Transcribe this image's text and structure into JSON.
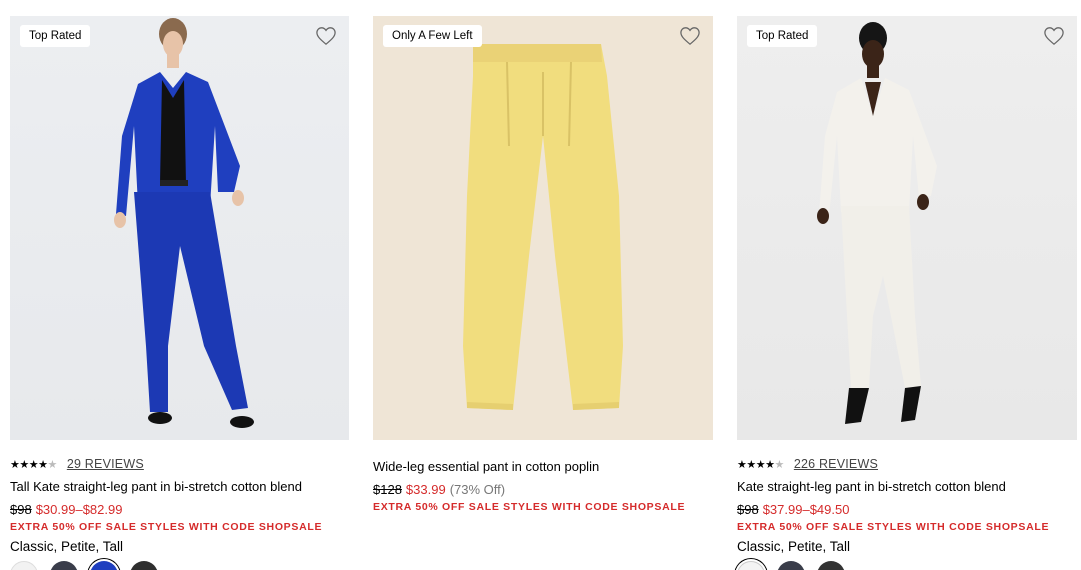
{
  "products": [
    {
      "badge": "Top Rated",
      "rating_stars": "★★★★",
      "rating_half": "★",
      "reviews": "29 REVIEWS",
      "title": "Tall Kate straight-leg pant in bi-stretch cotton blend",
      "price_was": "$98",
      "price_now": "$30.99–$82.99",
      "promo": "EXTRA 50% OFF SALE STYLES WITH CODE SHOPSALE",
      "sizes": "Classic, Petite, Tall",
      "swatch_colors": [
        "#f2f2f2",
        "#3a3d4a",
        "#1f3fbf",
        "#2f2f2f"
      ]
    },
    {
      "badge": "Only A Few Left",
      "title": "Wide-leg essential pant in cotton poplin",
      "price_was": "$128",
      "price_now": "$33.99",
      "price_off": "(73% Off)",
      "promo": "EXTRA 50% OFF SALE STYLES WITH CODE SHOPSALE"
    },
    {
      "badge": "Top Rated",
      "rating_stars": "★★★★",
      "rating_half": "★",
      "reviews": "226 REVIEWS",
      "title": "Kate straight-leg pant in bi-stretch cotton blend",
      "price_was": "$98",
      "price_now": "$37.99–$49.50",
      "promo": "EXTRA 50% OFF SALE STYLES WITH CODE SHOPSALE",
      "sizes": "Classic, Petite, Tall",
      "swatch_colors": [
        "#f4f4f4",
        "#3a3d4a",
        "#333333"
      ]
    }
  ],
  "icons": {
    "wishlist": "heart-outline-icon"
  },
  "colors": {
    "sale_red": "#d52b2b",
    "blue_suit": "#1f3fbf",
    "yellow_pant": "#f1dd7e",
    "white_suit": "#f3f1ec"
  }
}
